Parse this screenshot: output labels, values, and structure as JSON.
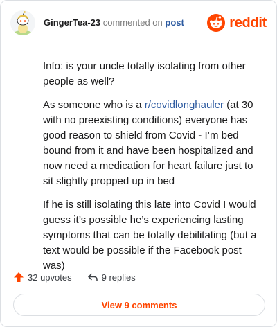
{
  "header": {
    "username": "GingerTea-23",
    "commented_text": "commented on",
    "post_link": "post",
    "brand": "reddit"
  },
  "comment": {
    "paragraphs": [
      {
        "text": "Info: is your uncle totally isolating from other people as well?"
      },
      {
        "before": "As someone who is a ",
        "link": "r/covidlonghauler",
        "after": " (at 30 with no preexisting conditions) everyone has good reason to shield from Covid - I’m bed bound from it and have been hospitalized and now need a medication for heart failure just to sit slightly propped up in bed"
      },
      {
        "text": "If he is still isolating this late into Covid I would guess it’s possible he’s experiencing lasting symptoms that can be totally debilitating (but a text would be possible if the Facebook post was)"
      }
    ]
  },
  "actions": {
    "upvotes": "32 upvotes",
    "replies": "9 replies"
  },
  "view_button": "View 9 comments",
  "colors": {
    "brand": "#ff4500",
    "link": "#2c5aa0",
    "text": "#1a1a1b",
    "muted": "#7c7c7c"
  }
}
